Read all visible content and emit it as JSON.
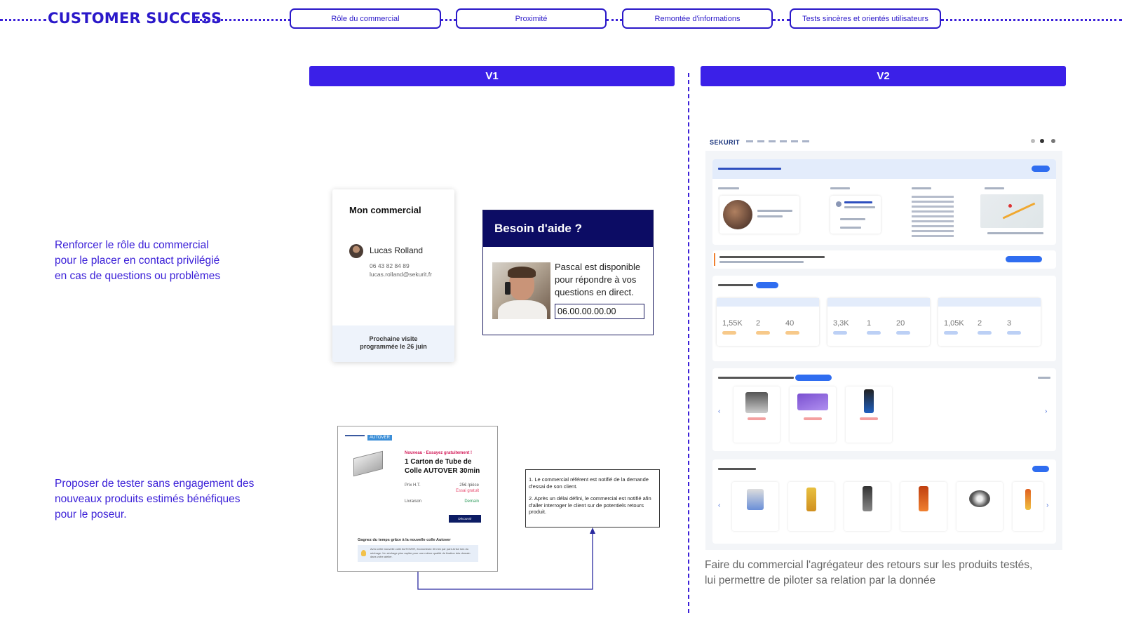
{
  "header": {
    "brand": "CUSTOMER SUCCESS",
    "pills": [
      "Rôle du commercial",
      "Proximité",
      "Remontée d'informations",
      "Tests sincères et orientés utilisateurs"
    ],
    "accent_color": "#2a18c9"
  },
  "versions": {
    "v1": "V1",
    "v2": "V2"
  },
  "left_texts": {
    "role": "Renforcer le rôle du commercial\npour le placer en contact privilégié\nen cas de questions ou problèmes",
    "test": "Proposer de tester sans engagement des\nnouveaux produits estimés bénéfiques\npour le poseur."
  },
  "commercial_card": {
    "title": "Mon commercial",
    "name": "Lucas Rolland",
    "phone": "06 43 82 84 89",
    "email": "lucas.rolland@sekurit.fr",
    "footer": "Prochaine visite\nprogrammée le 26 juin"
  },
  "help_card": {
    "title": "Besoin d'aide ?",
    "message": "Pascal est disponible pour répondre à vos questions en direct.",
    "phone_value": "06.00.00.00.00"
  },
  "autover_card": {
    "tag": "AUTOVER",
    "new_label": "Nouveau - Essayez gratuitement !",
    "title": "1 Carton de Tube de\nColle AUTOVER 30min",
    "price_label": "Prix H.T.",
    "price_value": "25€ /pièce",
    "trial_value": "Essai gratuit",
    "delivery_label": "Livraison",
    "delivery_value": "Demain",
    "button": "Découvrir",
    "gain_title": "Gagnez du temps grâce à la nouvelle colle Autover",
    "info_text": "Avec cette nouvelle colle AUTOVER, économisez 30 min par pare-brise lors du séchage. Un séchage plus rapide pour une même qualité de fixation dès demain dans votre atelier."
  },
  "notes": {
    "step1": "1. Le commercial référent est notifié de la demande d'essai de son client.",
    "step2": "2. Après un délai défini, le commercial est notifié afin d'aller interroger le client sur de potentiels retours produit."
  },
  "dashboard": {
    "logo": "SEKURIT",
    "kpi_values": [
      "1,55K",
      "2",
      "40",
      "3,3K",
      "1",
      "20",
      "1,05K",
      "2",
      "3"
    ],
    "caption": "Faire du commercial l'agrégateur des retours sur les produits testés,\nlui permettre de piloter sa relation par la donnée"
  }
}
